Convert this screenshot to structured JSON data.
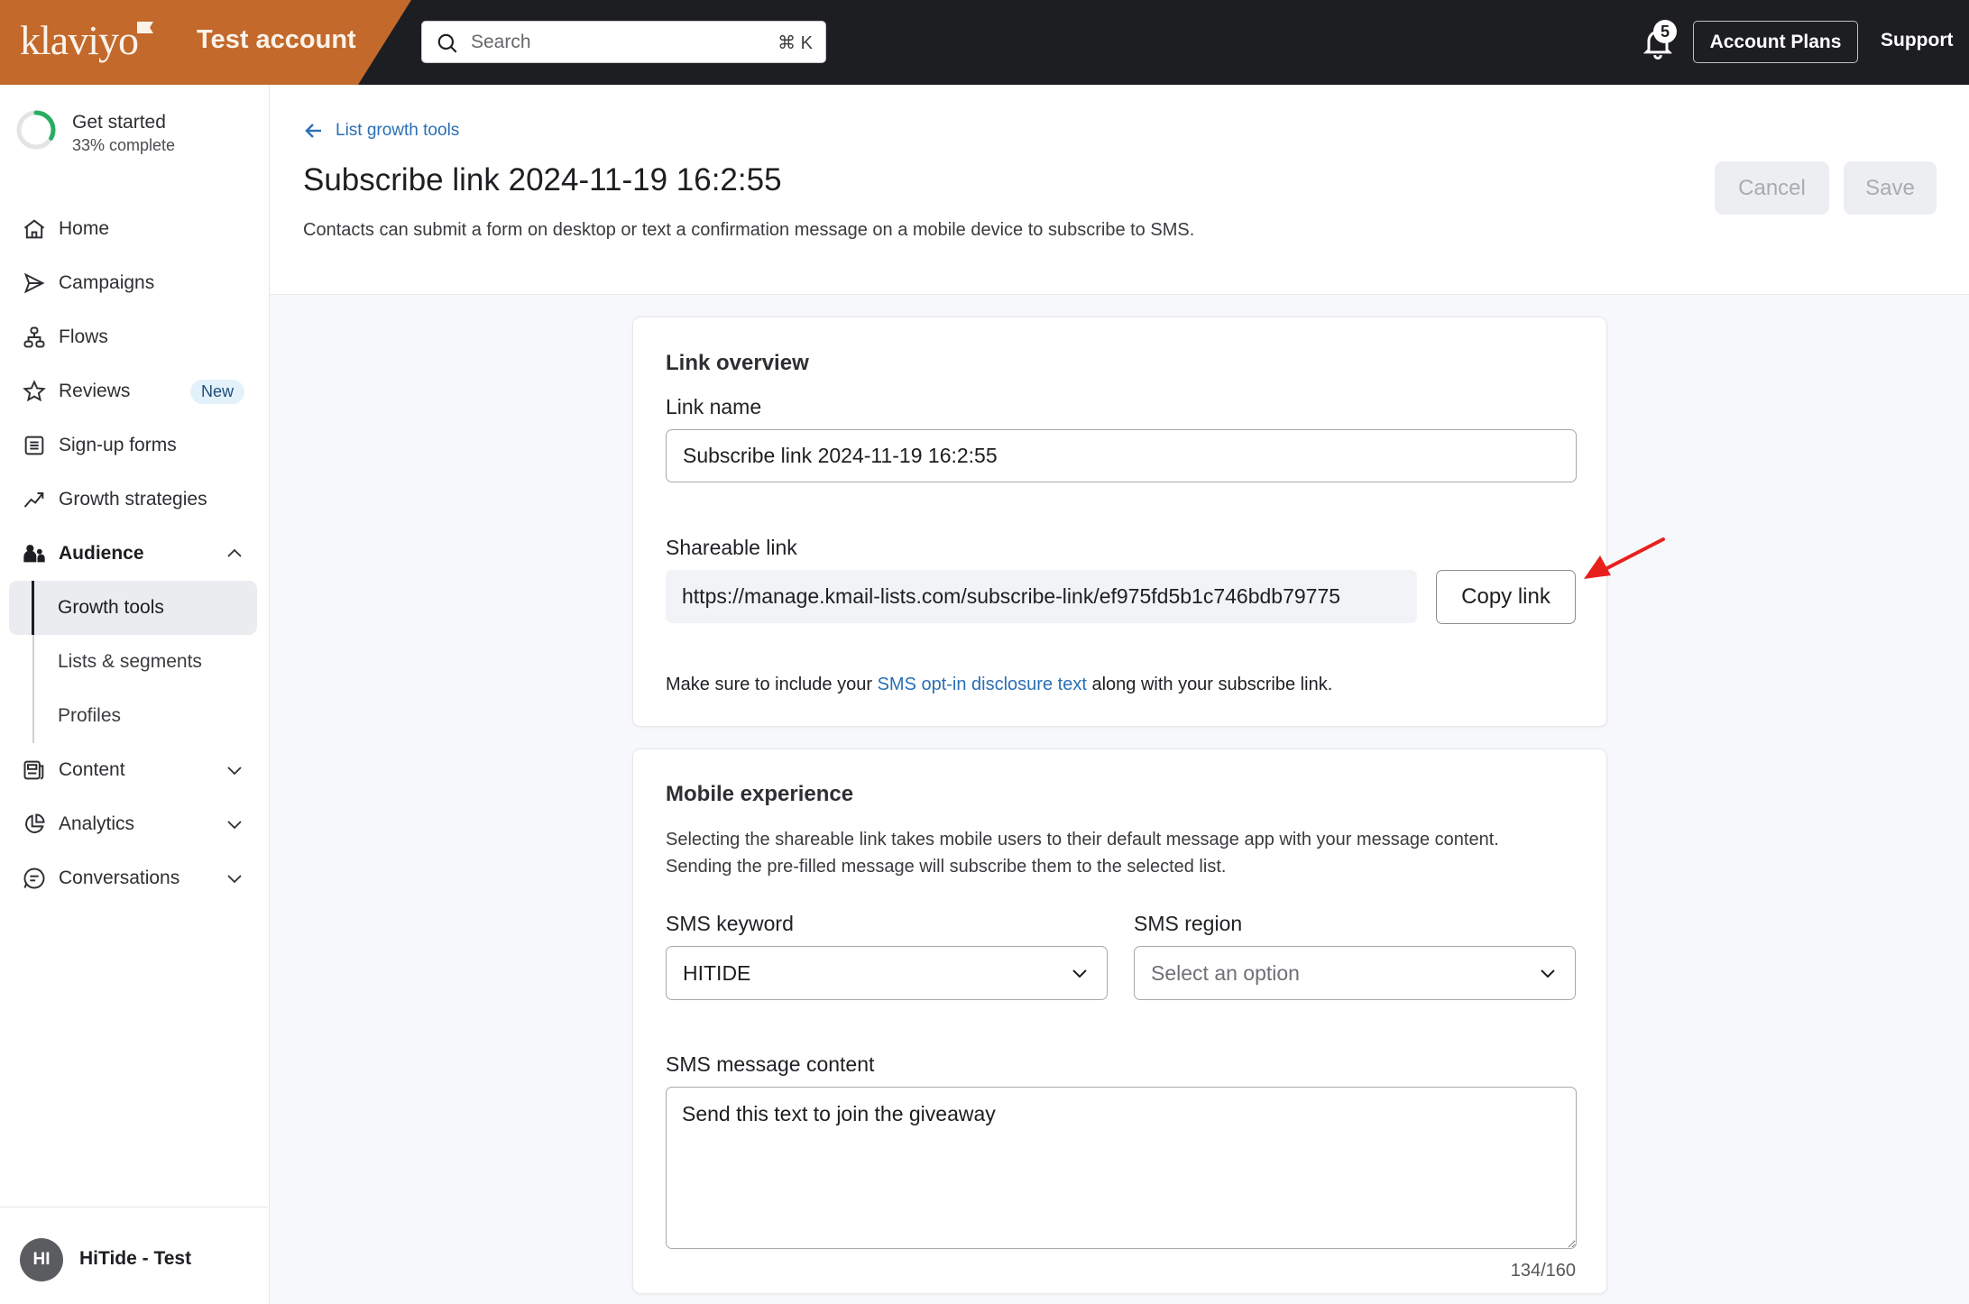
{
  "topbar": {
    "logo_text": "klaviyo",
    "account_name": "Test account",
    "search_placeholder": "Search",
    "search_shortcut": "⌘ K",
    "notification_count": "5",
    "account_plans_label": "Account Plans",
    "support_label": "Support",
    "brand_color": "#c2692b"
  },
  "sidebar": {
    "get_started": {
      "title": "Get started",
      "subtitle": "33% complete",
      "progress": 0.33
    },
    "items": [
      {
        "label": "Home",
        "icon": "home-icon"
      },
      {
        "label": "Campaigns",
        "icon": "send-icon"
      },
      {
        "label": "Flows",
        "icon": "flows-icon"
      },
      {
        "label": "Reviews",
        "icon": "star-icon",
        "badge": "New"
      },
      {
        "label": "Sign-up forms",
        "icon": "form-icon"
      },
      {
        "label": "Growth strategies",
        "icon": "trend-up-icon"
      },
      {
        "label": "Audience",
        "icon": "people-icon",
        "expanded": true
      },
      {
        "label": "Content",
        "icon": "content-icon"
      },
      {
        "label": "Analytics",
        "icon": "pie-chart-icon"
      },
      {
        "label": "Conversations",
        "icon": "chat-icon"
      }
    ],
    "audience_sub": [
      {
        "label": "Growth tools",
        "active": true
      },
      {
        "label": "Lists & segments"
      },
      {
        "label": "Profiles"
      }
    ],
    "user": {
      "initials": "HI",
      "name": "HiTide - Test"
    }
  },
  "header": {
    "back_label": "List growth tools",
    "title": "Subscribe link 2024-11-19 16:2:55",
    "subtitle": "Contacts can submit a form on desktop or text a confirmation message on a mobile device to subscribe to SMS.",
    "cancel_label": "Cancel",
    "save_label": "Save"
  },
  "link_overview": {
    "title": "Link overview",
    "link_name_label": "Link name",
    "link_name_value": "Subscribe link 2024-11-19 16:2:55",
    "shareable_label": "Shareable link",
    "shareable_value": "https://manage.kmail-lists.com/subscribe-link/ef975fd5b1c746bdb79775",
    "copy_label": "Copy link",
    "disclosure_before": "Make sure to include your ",
    "disclosure_link": "SMS opt-in disclosure text",
    "disclosure_after": " along with your subscribe link."
  },
  "mobile_experience": {
    "title": "Mobile experience",
    "description": "Selecting the shareable link takes mobile users to their default message app with your message content. Sending the pre-filled message will subscribe them to the selected list.",
    "keyword_label": "SMS keyword",
    "keyword_value": "HITIDE",
    "region_label": "SMS region",
    "region_placeholder": "Select an option",
    "message_label": "SMS message content",
    "message_value": "Send this text to join the giveaway",
    "char_count": "134/160"
  }
}
